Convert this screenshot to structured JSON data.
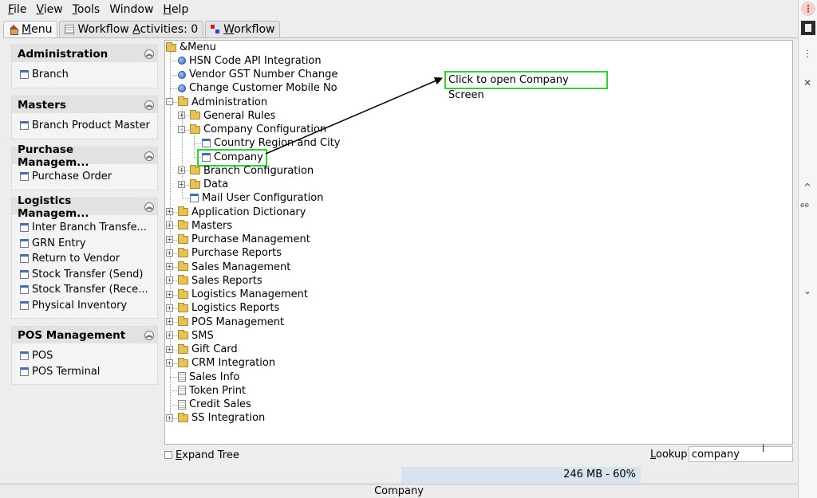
{
  "menubar": {
    "items": [
      {
        "label": "File",
        "mnemonic": "F",
        "rest": "ile"
      },
      {
        "label": "View",
        "mnemonic": "V",
        "rest": "iew"
      },
      {
        "label": "Tools",
        "mnemonic": "T",
        "rest": "ools"
      },
      {
        "label": "Window",
        "mnemonic": "",
        "rest": "Window"
      },
      {
        "label": "Help",
        "mnemonic": "H",
        "rest": "elp"
      }
    ]
  },
  "tabs": [
    {
      "label": "Menu",
      "mnemonic": "M",
      "rest": "enu",
      "icon": "home-icon",
      "active": true
    },
    {
      "label": "Workflow Activities: 0",
      "pre": "Workflow ",
      "mnemonic": "A",
      "rest": "ctivities: 0",
      "icon": "list-icon",
      "active": false
    },
    {
      "label": "Workflow",
      "mnemonic": "W",
      "rest": "orkflow",
      "icon": "flow-icon",
      "active": false
    }
  ],
  "groups": [
    {
      "title": "Administration",
      "items": [
        "Branch"
      ]
    },
    {
      "title": "Masters",
      "items": [
        "Branch Product Master"
      ]
    },
    {
      "title": "Purchase Managem...",
      "items": [
        "Purchase Order"
      ]
    },
    {
      "title": "Logistics Managem...",
      "items": [
        "Inter Branch Transfe...",
        "GRN Entry",
        "Return to Vendor",
        "Stock Transfer (Send)",
        "Stock Transfer (Rece...",
        "Physical Inventory"
      ]
    },
    {
      "title": "POS Management",
      "items": [
        "POS",
        "POS Terminal"
      ]
    }
  ],
  "tree": {
    "root": "&Menu",
    "nodes": [
      {
        "label": "HSN Code API Integration",
        "icon": "globe-icon",
        "level": 1
      },
      {
        "label": "Vendor GST Number Change",
        "icon": "globe-icon",
        "level": 1
      },
      {
        "label": "Change Customer Mobile No",
        "icon": "globe-icon",
        "level": 1
      },
      {
        "label": "Administration",
        "icon": "folder-icon",
        "level": 1,
        "expander": "-"
      },
      {
        "label": "General Rules",
        "icon": "folder-icon",
        "level": 2,
        "expander": "+"
      },
      {
        "label": "Company Configuration",
        "icon": "folder-icon",
        "level": 2,
        "expander": "-"
      },
      {
        "label": "Country Region and City",
        "icon": "win-icon",
        "level": 3
      },
      {
        "label": "Company",
        "icon": "win-icon",
        "level": 3,
        "highlight": true
      },
      {
        "label": "Branch Configuration",
        "icon": "folder-icon",
        "level": 2,
        "expander": "+"
      },
      {
        "label": "Data",
        "icon": "folder-icon",
        "level": 2,
        "expander": "+"
      },
      {
        "label": "Mail User Configuration",
        "icon": "win-icon",
        "level": 2
      },
      {
        "label": "Application Dictionary",
        "icon": "folder-icon",
        "level": 1,
        "expander": "+"
      },
      {
        "label": "Masters",
        "icon": "folder-icon",
        "level": 1,
        "expander": "+"
      },
      {
        "label": "Purchase Management",
        "icon": "folder-icon",
        "level": 1,
        "expander": "+"
      },
      {
        "label": "Purchase Reports",
        "icon": "folder-icon",
        "level": 1,
        "expander": "+"
      },
      {
        "label": "Sales Management",
        "icon": "folder-icon",
        "level": 1,
        "expander": "+"
      },
      {
        "label": "Sales Reports",
        "icon": "folder-icon",
        "level": 1,
        "expander": "+"
      },
      {
        "label": "Logistics Management",
        "icon": "folder-icon",
        "level": 1,
        "expander": "+"
      },
      {
        "label": "Logistics Reports",
        "icon": "folder-icon",
        "level": 1,
        "expander": "+"
      },
      {
        "label": "POS Management",
        "icon": "folder-icon",
        "level": 1,
        "expander": "+"
      },
      {
        "label": "SMS",
        "icon": "folder-icon",
        "level": 1,
        "expander": "+"
      },
      {
        "label": "Gift Card",
        "icon": "folder-icon",
        "level": 1,
        "expander": "+"
      },
      {
        "label": "CRM Integration",
        "icon": "folder-icon",
        "level": 1,
        "expander": "+"
      },
      {
        "label": "Sales Info",
        "icon": "doc-icon",
        "level": 1
      },
      {
        "label": "Token Print",
        "icon": "doc-icon",
        "level": 1
      },
      {
        "label": "Credit Sales",
        "icon": "doc-icon",
        "level": 1
      },
      {
        "label": "SS Integration",
        "icon": "folder-icon",
        "level": 1,
        "expander": "+"
      }
    ]
  },
  "callout": {
    "text": "Click to open Company Screen",
    "border_color": "#2fd02f"
  },
  "bottom": {
    "expand_tree": {
      "pre": "",
      "mnemonic": "E",
      "rest": "xpand Tree"
    },
    "lookup": {
      "mnemonic": "L",
      "rest": "ookup",
      "value": "company"
    }
  },
  "memory": "246 MB - 60%",
  "status": "Company",
  "right_strip": {
    "snippet": "ee"
  }
}
